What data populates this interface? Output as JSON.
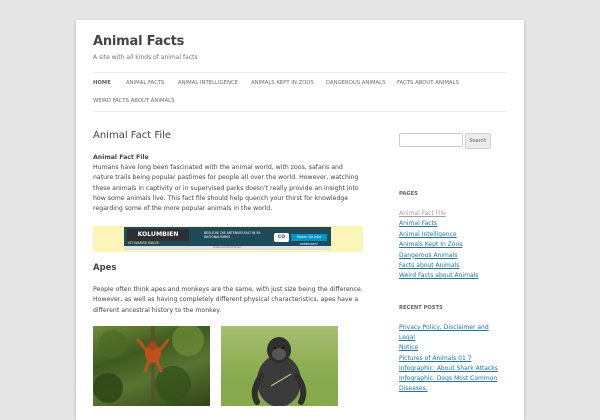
{
  "site": {
    "title": "Animal Facts",
    "description": "A site with all kinds of animal facts"
  },
  "nav": {
    "items": [
      {
        "label": "Home"
      },
      {
        "label": "Animal Facts"
      },
      {
        "label": "Animal Intelligence"
      },
      {
        "label": "Animals Kept In Zoos"
      },
      {
        "label": "Dangerous Animals"
      },
      {
        "label": "Facts About Animals"
      },
      {
        "label": "Weird Facts About Animals"
      }
    ]
  },
  "entry": {
    "title": "Animal Fact File",
    "subheading": "Animal Fact File",
    "body": "Humans have long been fascinated with the animal world, with zoos, safaris and nature trails being popular pastimes for people all over the world. However, watching these animals in captivity or in supervised parks doesn't really provide an insight into how some animals live. This fact file should help quench your thirst for knowledge regarding some of the more popular animals in the world."
  },
  "ad": {
    "brand": "KOLUMBIEN",
    "tagline": "IST WAHRE MAGIE",
    "text": "BESUCHE DIE ARTENVIELFALT IN 59 NATIONALPARKS",
    "logo": "CO",
    "button": "Reisen Sie jetzt entdecken!",
    "footer": "Datenschutzrichtlinien"
  },
  "section": {
    "title": "Apes",
    "body": "People often think apes and monkeys are the same, with just size being the difference. However, as well as having completely different physical characteristics, apes have a different ancestral history to the monkey."
  },
  "sidebar": {
    "search": {
      "placeholder": "",
      "button_label": "Search"
    },
    "pages": {
      "title": "Pages",
      "items": [
        "Animal Fact File",
        "Animal Facts",
        "Animal Intelligence",
        "Animals Kept In Zoos",
        "Dangerous Animals",
        "Facts about Animals",
        "Weird Facts about Animals"
      ]
    },
    "recent_posts": {
      "title": "Recent Posts",
      "items": [
        "Privacy Policy, Disclaimer and Legal",
        "Notice",
        "Pictures of Animals 01 7",
        "Infographic: About Shark Attacks",
        "Infographic: Dogs Most Common",
        "Diseases."
      ]
    }
  },
  "colors": {
    "link": "#21759b",
    "current_link": "#9f9f9f",
    "page_background": "#e6e6e6",
    "ad_background": "#fbf5b8"
  }
}
